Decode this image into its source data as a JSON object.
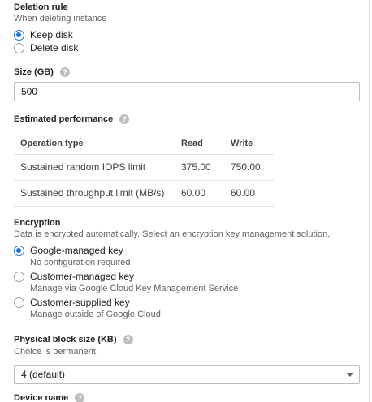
{
  "deletion_rule": {
    "title": "Deletion rule",
    "subtitle": "When deleting instance",
    "options": [
      {
        "label": "Keep disk",
        "selected": true
      },
      {
        "label": "Delete disk",
        "selected": false
      }
    ]
  },
  "size": {
    "label": "Size (GB)",
    "value": "500",
    "help_icon": "help-icon"
  },
  "performance": {
    "title": "Estimated performance",
    "columns": [
      "Operation type",
      "Read",
      "Write"
    ],
    "rows": [
      {
        "operation": "Sustained random IOPS limit",
        "read": "375.00",
        "write": "750.00"
      },
      {
        "operation": "Sustained throughput limit (MB/s)",
        "read": "60.00",
        "write": "60.00"
      }
    ]
  },
  "encryption": {
    "title": "Encryption",
    "subtitle": "Data is encrypted automatically. Select an encryption key management solution.",
    "options": [
      {
        "label": "Google-managed key",
        "description": "No configuration required",
        "selected": true
      },
      {
        "label": "Customer-managed key",
        "description": "Manage via Google Cloud Key Management Service",
        "selected": false
      },
      {
        "label": "Customer-supplied key",
        "description": "Manage outside of Google Cloud",
        "selected": false
      }
    ]
  },
  "block_size": {
    "label": "Physical block size (KB)",
    "subtitle": "Choice is permanent.",
    "selected": "4 (default)"
  },
  "device_name": {
    "label": "Device name"
  },
  "colors": {
    "accent": "#1a73e8",
    "text": "#212121",
    "secondary_text": "#616161",
    "border": "#bdbdbd"
  }
}
